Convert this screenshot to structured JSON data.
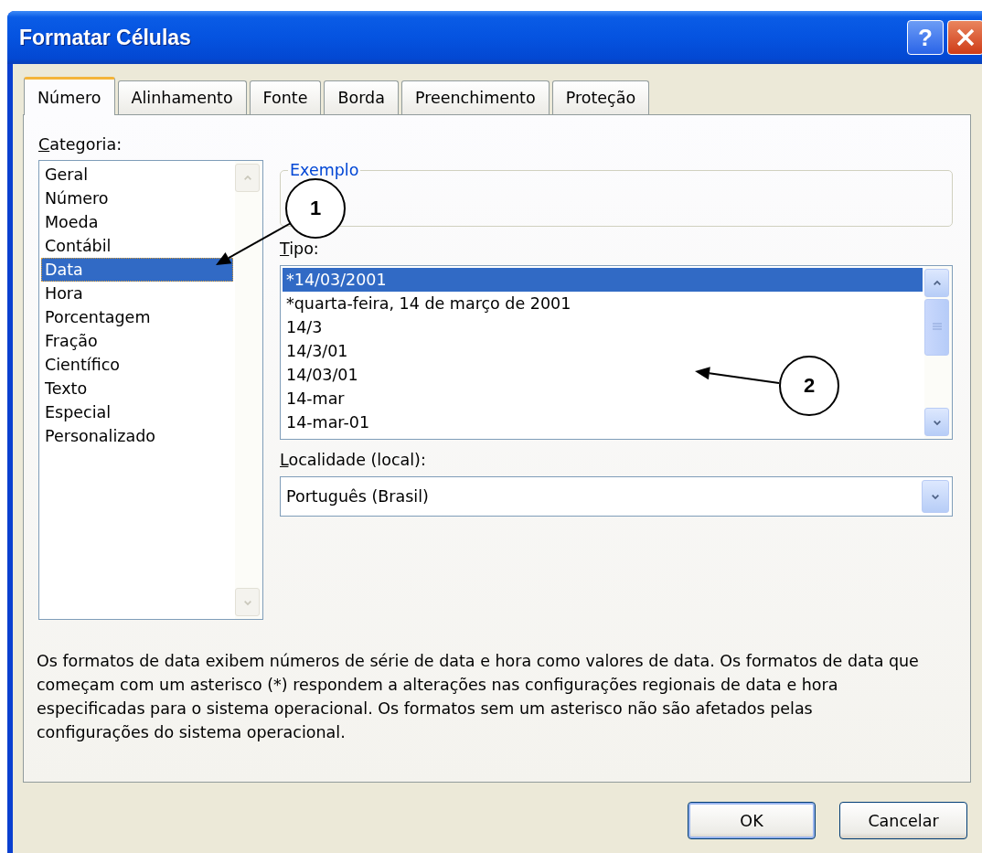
{
  "window": {
    "title": "Formatar Células",
    "buttons": [
      {
        "kind": "help",
        "label": "?"
      },
      {
        "kind": "close"
      }
    ]
  },
  "tabs": [
    {
      "label": "Número",
      "selected": true
    },
    {
      "label": "Alinhamento",
      "selected": false
    },
    {
      "label": "Fonte",
      "selected": false
    },
    {
      "label": "Borda",
      "selected": false
    },
    {
      "label": "Preenchimento",
      "selected": false
    },
    {
      "label": "Proteção",
      "selected": false
    }
  ],
  "categoria": {
    "label": "Categoria:",
    "items": [
      {
        "label": "Geral",
        "selected": false
      },
      {
        "label": "Número",
        "selected": false
      },
      {
        "label": "Moeda",
        "selected": false
      },
      {
        "label": "Contábil",
        "selected": false
      },
      {
        "label": "Data",
        "selected": true
      },
      {
        "label": "Hora",
        "selected": false
      },
      {
        "label": "Porcentagem",
        "selected": false
      },
      {
        "label": "Fração",
        "selected": false
      },
      {
        "label": "Científico",
        "selected": false
      },
      {
        "label": "Texto",
        "selected": false
      },
      {
        "label": "Especial",
        "selected": false
      },
      {
        "label": "Personalizado",
        "selected": false
      }
    ]
  },
  "exemplo": {
    "label": "Exemplo"
  },
  "tipo": {
    "label": "Tipo:",
    "items": [
      {
        "label": "*14/03/2001",
        "selected": true
      },
      {
        "label": "*quarta-feira, 14 de março de 2001",
        "selected": false
      },
      {
        "label": "14/3",
        "selected": false
      },
      {
        "label": "14/3/01",
        "selected": false
      },
      {
        "label": "14/03/01",
        "selected": false
      },
      {
        "label": "14-mar",
        "selected": false
      },
      {
        "label": "14-mar-01",
        "selected": false
      }
    ]
  },
  "localidade": {
    "label": "Localidade (local):",
    "value": "Português (Brasil)"
  },
  "description": "Os formatos de data exibem números de série de data e hora como valores de data. Os formatos de data que começam com um asterisco (*) respondem a alterações nas configurações regionais de data e hora especificadas para o sistema operacional. Os formatos sem um asterisco não são afetados pelas configurações do sistema operacional.",
  "buttons": [
    {
      "label": "OK",
      "default": true
    },
    {
      "label": "Cancelar",
      "default": false
    }
  ],
  "annotations": [
    {
      "label": "1"
    },
    {
      "label": "2"
    }
  ]
}
